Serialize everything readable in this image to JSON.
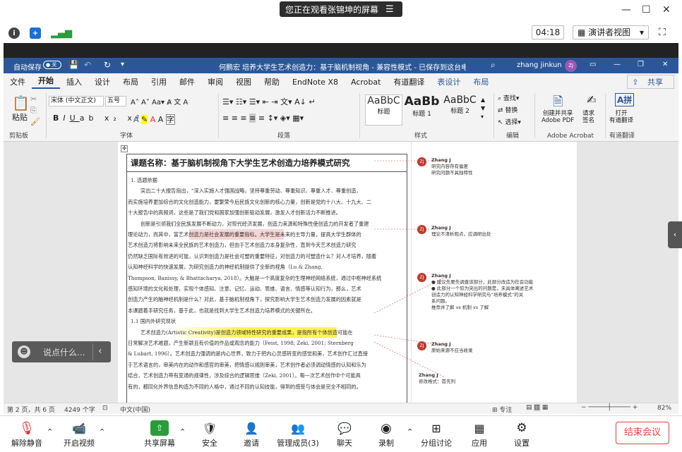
{
  "meeting": {
    "banner": "您正在观看张锦坤的屏幕",
    "timer": "04:18",
    "speaker_view": "演讲者视图"
  },
  "word": {
    "autosave": "自动保存",
    "title": "何鹏宏 培养大学生艺术创造力：基于脑机制视角 - 兼容性模式 - 已保存到这台电脑",
    "user": "zhang jinkun",
    "user_initials": "ZJ",
    "tabs": [
      "文件",
      "开始",
      "插入",
      "设计",
      "布局",
      "引用",
      "邮件",
      "审阅",
      "视图",
      "帮助",
      "EndNote X8",
      "Acrobat",
      "有道翻译",
      "表设计",
      "布局"
    ],
    "share": "共享",
    "ribbon": {
      "paste": "粘贴",
      "font_name": "宋体 (中文正文)",
      "font_size": "五号",
      "styles": [
        {
          "preview": "AaBbC",
          "label": "标题"
        },
        {
          "preview": "AaBb",
          "label": "标题 1"
        },
        {
          "preview": "AaBbC",
          "label": "标题 2"
        }
      ],
      "find": "查找",
      "replace": "替换",
      "select": "选择",
      "pdf": "创建并共享\nAdobe PDF",
      "sign": "请求\n签名",
      "youdao": "打开\n有道翻译",
      "groups": [
        "剪贴板",
        "字体",
        "段落",
        "样式",
        "编辑",
        "Adobe Acrobat",
        "有道翻译"
      ]
    },
    "doc": {
      "heading": "课题名称：基于脑机制视角下大学生艺术创造力培养模式研究",
      "lines": [
        "1. 选题依据",
        "突出二十大报告指出，“深入实施人才强国战略，坚持尊重劳动、尊重知识、尊重人才、尊重创造，",
        "而实施培养更加综合的文化创造能力，要繁荣今后民族文化创新的核心力量，创新是党的十八大、十九大、二",
        "十大报告中的高频词，这些是了我们党和国家加强创新驱动发展，激发人才创新活力不断推进。",
        "创新是引领我们全民族发展不断动力，对现代经济发展，创造力来源和特殊性使创造力的开发者了重建",
        "理论动力，而其中，富艺术创造力是社会发展的重要指标。大学生是未来的主导力量，提高大学生群体的",
        "艺术创造力将影响未来全民族的艺术创造力，但由于艺术创造力本身复杂性，直到今天艺术创造力研究",
        "仍然缺乏国际有效进的可能，认识到创造力是社会可塑的重要特征，对创造力的可塑造什么？对人才培养，随着",
        "认知神经科学的快速发展，为研究创造力的神经机制提供了全新的视角（Lu & Zhang,",
        "Thompson, Banissy, & Bhattacharya, 2018）。大脑是一个高度复杂的生理神经网络系统，通过中枢神经系统",
        "感知环境的文化和处理，实现个体感知、注意、记忆、运动、思维、语言、情感等认知行为，那么，艺术",
        "创造力产生的脑神经机制是什么？对此，基于脑机制视角下，探究影响大学生艺术创造力发展的因素就是",
        "本课题着手研究任务，基于此，也就是找到大学生艺术创造力培养模式的关键所在。",
        "1.1 国内外研究现状",
        "艺术创造力(Artistic Creativity)是创造力领域特性研究的重要成果，是指所有个体创造可能在",
        "日常解决艺术难题，产生新颖且有价值的作品或观念的能力（Feist, 1998; Zeki, 2001; Sternberg",
        "& Lubart, 1996）。艺术创造力强调的是内心世界，致力于把内心灵感转变的感觉和美，艺术创作汇过直接",
        "于艺术语言的，审美内在的动作和感官的审美，把情感以规则审美，艺术创作者必须调动情感的认知和乐为",
        "结合，艺术创造力带有变通的规律性，涉及综合的逻辑思维（Zeki, 2001）。每一次艺术创作中个可能具",
        "有的，都同化外界信息构造为不同的人格中，通过不同的认知技能，得到的感受与体会是完全不相同的。"
      ]
    },
    "comments": [
      {
        "author": "Zhang J",
        "text": "研究内容存有偏差\n研究问题不具独特性"
      },
      {
        "author": "Zhang J",
        "text": "理论不清析观点，应调研出处"
      },
      {
        "author": "Zhang J",
        "text": "● 建议先要先调查该部分，此部分改造为社会功能\n● 此部分一个较为突出的问题是，未具体阐述艺术\n创造力的认知神经科学研究与“培养模式”的关\n系问题。\n推荐并了解 vs 机制 vs 了解"
      },
      {
        "author": "Zhang J",
        "text": "原始来源不应当收录"
      },
      {
        "author": "Zhang J",
        "text": "修改格式：首先列"
      }
    ],
    "status": {
      "page": "第 2 页，共 6 页",
      "words": "4249 个字",
      "lang": "中文(中国)",
      "focus": "专注",
      "zoom": "82%"
    }
  },
  "chat": {
    "placeholder": "说点什么..."
  },
  "toolbar": {
    "mute": "解除静音",
    "video": "开启视频",
    "share": "共享屏幕",
    "security": "安全",
    "invite": "邀请",
    "members": "管理成员(3)",
    "chat": "聊天",
    "record": "录制",
    "breakout": "分组讨论",
    "apps": "应用",
    "settings": "设置",
    "end": "结束会议"
  }
}
